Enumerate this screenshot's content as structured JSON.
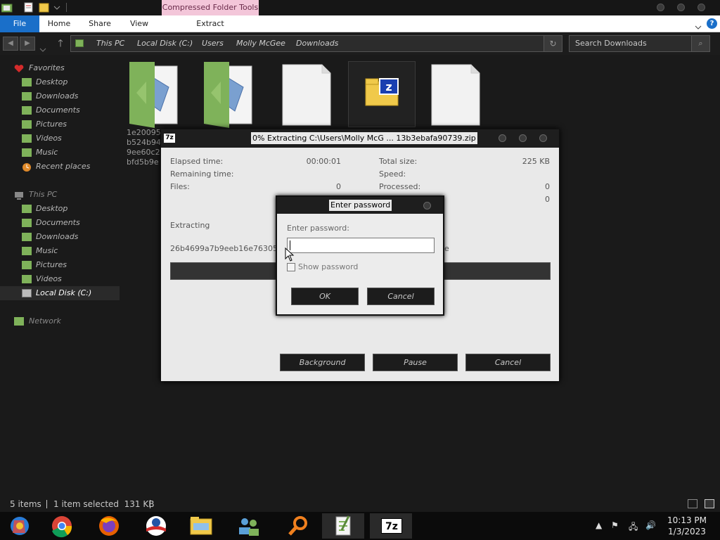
{
  "window": {
    "context_tab": "Compressed Folder Tools"
  },
  "ribbon": {
    "tabs": [
      "File",
      "Home",
      "Share",
      "View",
      "Extract"
    ]
  },
  "address": {
    "crumbs": [
      "This PC",
      "Local Disk (C:)",
      "Users",
      "Molly McGee",
      "Downloads"
    ],
    "search_placeholder": "Search Downloads"
  },
  "sidebar": {
    "favorites_header": "Favorites",
    "favorites": [
      "Desktop",
      "Downloads",
      "Documents",
      "Pictures",
      "Videos",
      "Music",
      "Recent places"
    ],
    "thispc_header": "This PC",
    "thispc": [
      "Desktop",
      "Documents",
      "Downloads",
      "Music",
      "Pictures",
      "Videos",
      "Local Disk (C:)"
    ],
    "network": "Network"
  },
  "files": {
    "partial_name_lines": [
      "1e20095",
      "b524b94",
      "9ee60c2",
      "bfd5b9e"
    ]
  },
  "zip_window": {
    "title": "0% Extracting C:\\Users\\Molly McG ... 13b3ebafa90739.zip",
    "logo": "7z",
    "elapsed_label": "Elapsed time:",
    "elapsed_value": "00:00:01",
    "remaining_label": "Remaining time:",
    "files_label": "Files:",
    "files_value": "0",
    "total_size_label": "Total size:",
    "total_size_value": "225 KB",
    "speed_label": "Speed:",
    "processed_label": "Processed:",
    "processed_value": "0",
    "extra_value": "0",
    "extracting_label": "Extracting",
    "current_file": "26b4699a7b9eeb16e76305d84",
    "current_file_tail": "e",
    "progress": 0,
    "buttons": {
      "background": "Background",
      "pause": "Pause",
      "cancel": "Cancel"
    }
  },
  "password_dialog": {
    "title": "Enter password",
    "label": "Enter password:",
    "value": "",
    "show_password_label": "Show password",
    "show_password_checked": false,
    "ok": "OK",
    "cancel": "Cancel"
  },
  "statusbar": {
    "items_count": "5 items",
    "selection": "1 item selected  131 KB"
  },
  "taskbar": {
    "apps": [
      "chrome-os-icon",
      "chrome-icon",
      "firefox-icon",
      "obama-logo-icon",
      "file-explorer-icon",
      "network-people-icon",
      "search-magnifier-icon",
      "notepad-icon",
      "7zip-icon"
    ],
    "logo_7z": "7z",
    "time": "10:13 PM",
    "date": "1/3/2023"
  },
  "colors": {
    "accent_blue": "#1a6fc9",
    "context_tab_pink": "#f3c6d9",
    "folder_green": "#7fb25a"
  }
}
